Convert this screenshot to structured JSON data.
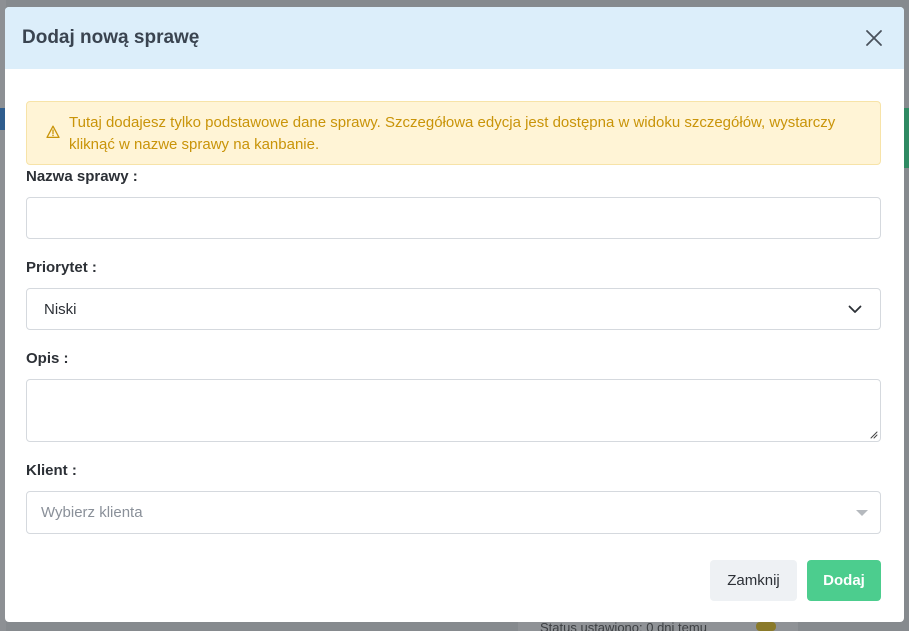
{
  "modal": {
    "title": "Dodaj nową sprawę",
    "close_icon": "close-icon"
  },
  "alert": {
    "icon": "warning-icon",
    "text": "Tutaj dodajesz tylko podstawowe dane sprawy. Szczegółowa edycja jest dostępna w widoku szczegółów, wystarczy kliknąć w nazwe sprawy na kanbanie.",
    "color": "#c99409"
  },
  "form": {
    "name_label": "Nazwa sprawy :",
    "name_value": "",
    "priority_label": "Priorytet :",
    "priority_value": "Niski",
    "description_label": "Opis :",
    "description_value": "",
    "client_label": "Klient :",
    "client_placeholder": "Wybierz klienta"
  },
  "footer": {
    "close_label": "Zamknij",
    "add_label": "Dodaj",
    "add_color": "#4ccd8e"
  },
  "background": {
    "status_text": "Status ustawiono: 0 dni temu"
  }
}
